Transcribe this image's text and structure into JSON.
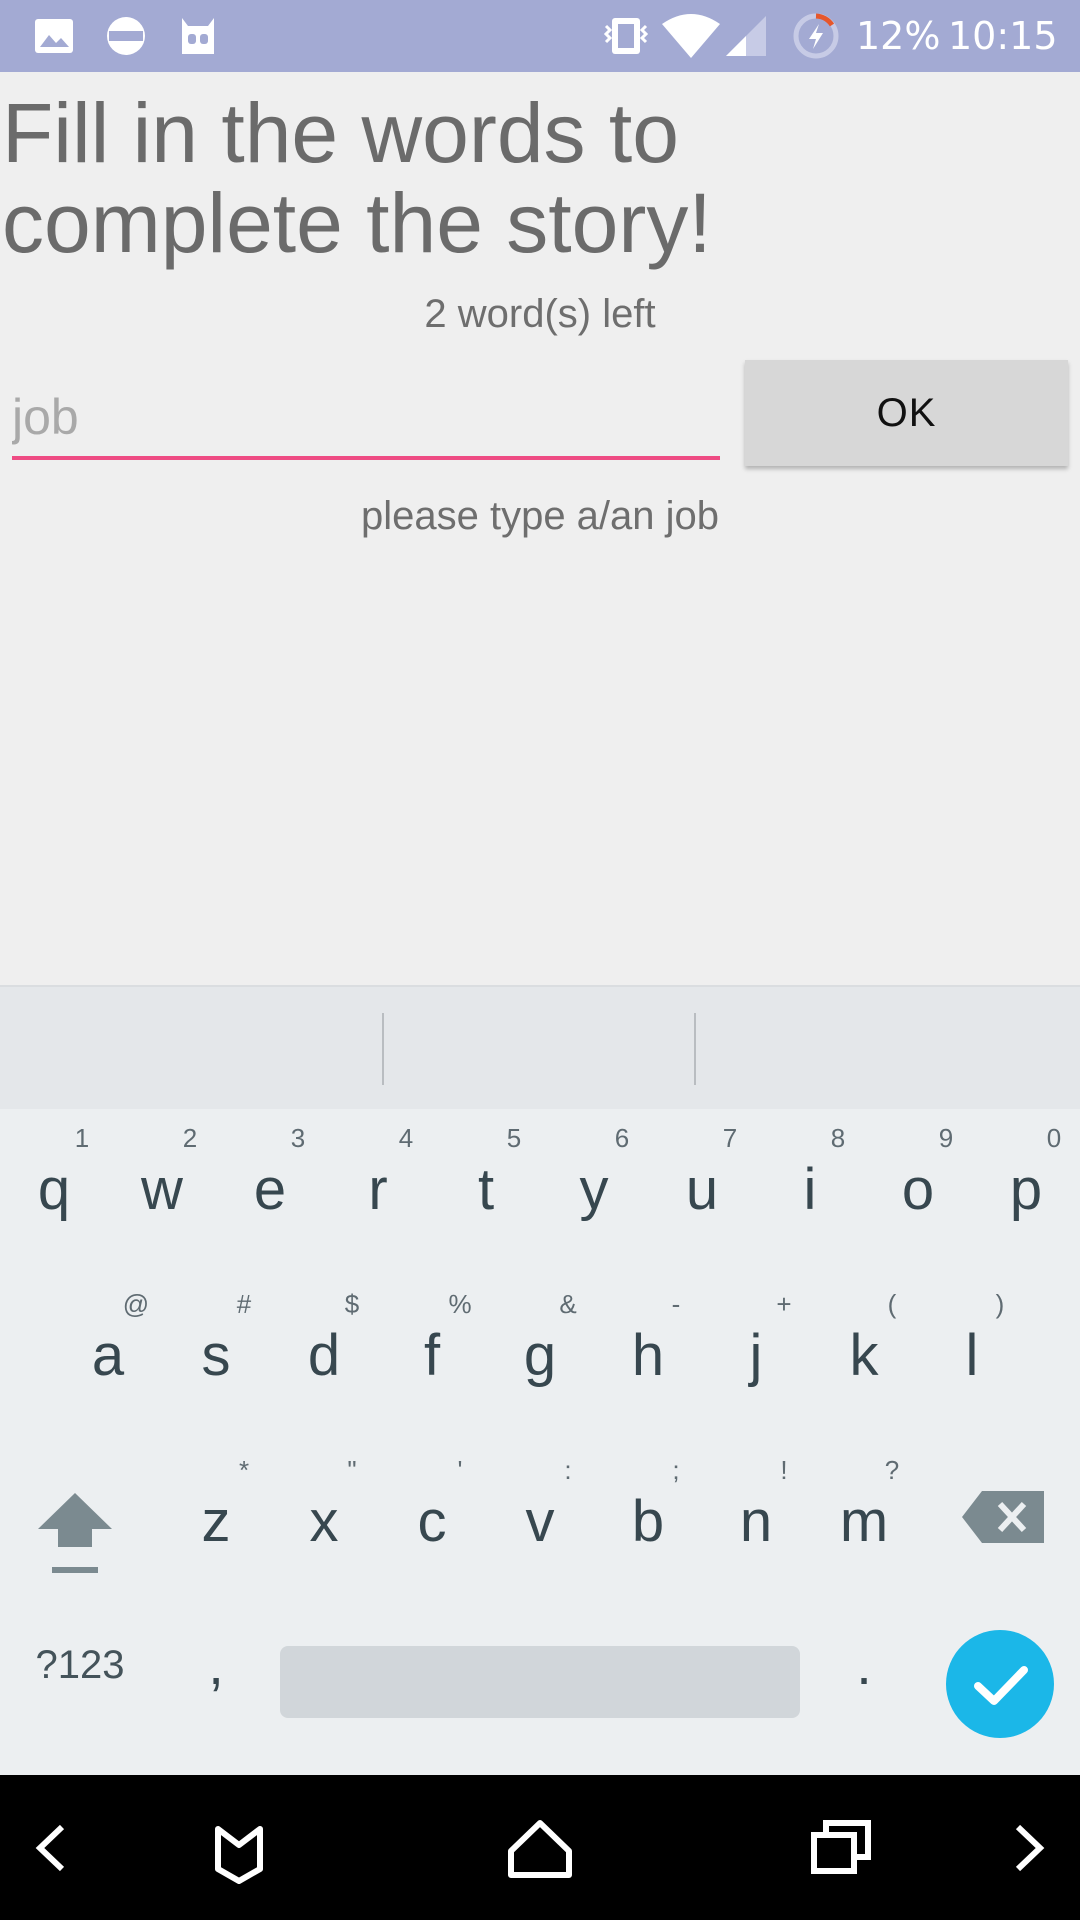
{
  "status_bar": {
    "background": "#a3aad3",
    "left_icons": [
      "gallery-icon",
      "messenger-icon",
      "robot-icon"
    ],
    "right_icons": [
      "vibrate-icon",
      "wifi-icon",
      "signal-icon",
      "battery-charging-icon"
    ],
    "battery_level": "12%",
    "time": "10:15"
  },
  "main": {
    "heading": "Fill in the words to complete the story!",
    "words_left": "2 word(s) left",
    "input": {
      "value": "",
      "placeholder": "job",
      "underline_color": "#ee4b83"
    },
    "ok_label": "OK",
    "hint": "please type a/an job"
  },
  "keyboard": {
    "row1": [
      {
        "ch": "q",
        "hint": "1"
      },
      {
        "ch": "w",
        "hint": "2"
      },
      {
        "ch": "e",
        "hint": "3"
      },
      {
        "ch": "r",
        "hint": "4"
      },
      {
        "ch": "t",
        "hint": "5"
      },
      {
        "ch": "y",
        "hint": "6"
      },
      {
        "ch": "u",
        "hint": "7"
      },
      {
        "ch": "i",
        "hint": "8"
      },
      {
        "ch": "o",
        "hint": "9"
      },
      {
        "ch": "p",
        "hint": "0"
      }
    ],
    "row2": [
      {
        "ch": "a",
        "hint": "@"
      },
      {
        "ch": "s",
        "hint": "#"
      },
      {
        "ch": "d",
        "hint": "$"
      },
      {
        "ch": "f",
        "hint": "%"
      },
      {
        "ch": "g",
        "hint": "&"
      },
      {
        "ch": "h",
        "hint": "-"
      },
      {
        "ch": "j",
        "hint": "+"
      },
      {
        "ch": "k",
        "hint": "("
      },
      {
        "ch": "l",
        "hint": ")"
      }
    ],
    "row3": [
      {
        "ch": "z",
        "hint": "*"
      },
      {
        "ch": "x",
        "hint": "\""
      },
      {
        "ch": "c",
        "hint": "'"
      },
      {
        "ch": "v",
        "hint": ":"
      },
      {
        "ch": "b",
        "hint": ";"
      },
      {
        "ch": "n",
        "hint": "!"
      },
      {
        "ch": "m",
        "hint": "?"
      }
    ],
    "symbols_label": "?123",
    "comma": ",",
    "period": ".",
    "enter_color": "#1bb7e8",
    "special_icons": [
      "shift-icon",
      "backspace-icon",
      "checkmark-icon"
    ]
  },
  "nav_bar": {
    "icons": [
      "back-icon",
      "mail-icon",
      "home-icon",
      "recents-icon",
      "forward-icon"
    ]
  }
}
